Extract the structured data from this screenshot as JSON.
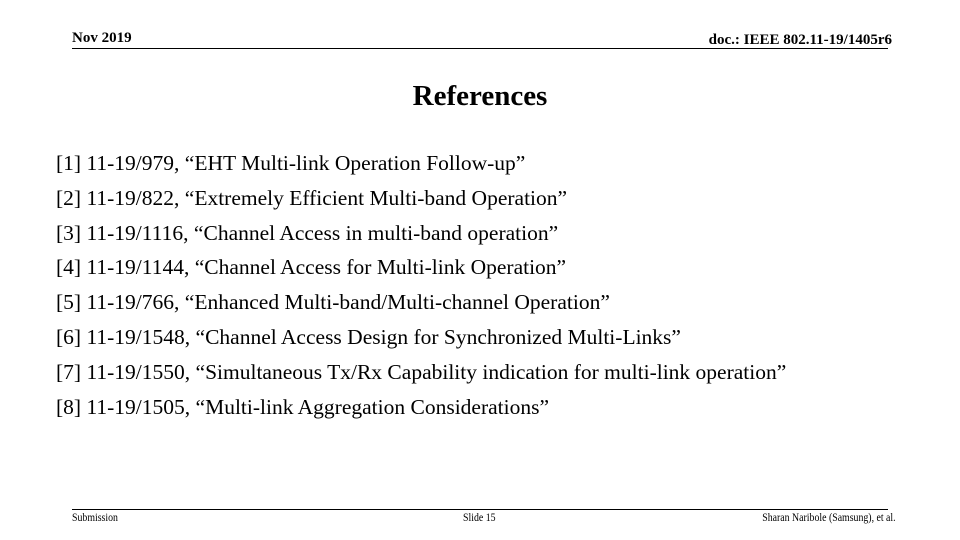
{
  "header": {
    "date": "Nov 2019",
    "doc_id": "doc.: IEEE 802.11-19/1405r6"
  },
  "slide": {
    "title": "References",
    "references": [
      "[1] 11-19/979, “EHT Multi-link Operation Follow-up”",
      "[2] 11-19/822, “Extremely Efficient Multi-band Operation”",
      "[3] 11-19/1116, “Channel Access in multi-band operation”",
      "[4] 11-19/1144, “Channel Access for Multi-link Operation”",
      "[5] 11-19/766, “Enhanced Multi-band/Multi-channel Operation”",
      "[6] 11-19/1548, “Channel Access Design for Synchronized Multi-Links”",
      "[7] 11-19/1550, “Simultaneous Tx/Rx Capability indication for multi-link operation”",
      "[8] 11-19/1505, “Multi-link Aggregation Considerations”"
    ]
  },
  "footer": {
    "left": "Submission",
    "center": "Slide 15",
    "right": "Sharan Naribole (Samsung), et al."
  }
}
